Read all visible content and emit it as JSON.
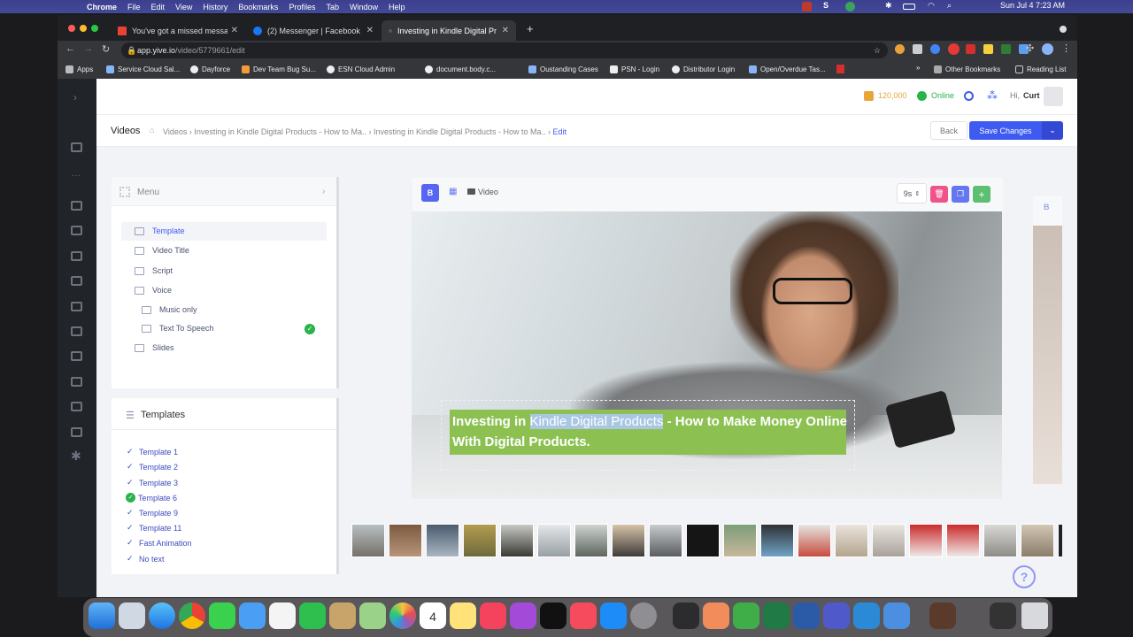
{
  "mac_menubar": {
    "app_name": "Chrome",
    "menus": [
      "File",
      "Edit",
      "View",
      "History",
      "Bookmarks",
      "Profiles",
      "Tab",
      "Window",
      "Help"
    ],
    "clock": "Sun Jul 4  7:23 AM"
  },
  "browser": {
    "tabs": [
      {
        "title": "You've got a missed message",
        "favicon": "gmail-icon"
      },
      {
        "title": "(2) Messenger | Facebook",
        "favicon": "facebook-icon"
      },
      {
        "title": "Investing in Kindle Digital Prod",
        "favicon": "yive-icon"
      }
    ],
    "url_host": "app.yive.io",
    "url_path": "/video/5779661/edit",
    "bookmarks": [
      "Apps",
      "Service Cloud Sal...",
      "Dayforce",
      "Dev Team Bug Su...",
      "ESN Cloud Admin",
      "document.body.c...",
      "Oustanding Cases",
      "PSN - Login",
      "Distributor Login",
      "Open/Overdue Tas..."
    ],
    "other_bookmarks": "Other Bookmarks",
    "reading_list": "Reading List"
  },
  "header": {
    "credits": "120,000",
    "status": "Online",
    "greeting": "Hi,",
    "user": "Curt"
  },
  "subheader": {
    "page_title": "Videos",
    "breadcrumb": [
      "Videos",
      "Investing in Kindle Digital Products - How to Ma..",
      "Investing in Kindle Digital Products - How to Ma..",
      "Edit"
    ],
    "back_label": "Back",
    "save_label": "Save Changes"
  },
  "menu": {
    "title": "Menu",
    "items": [
      {
        "label": "Template",
        "icon": "sliders-icon",
        "active": true
      },
      {
        "label": "Video Title",
        "icon": "pencil-icon"
      },
      {
        "label": "Script",
        "icon": "document-icon"
      },
      {
        "label": "Voice",
        "icon": "speaker-icon"
      },
      {
        "label": "Music only",
        "icon": "music-icon",
        "sub": true
      },
      {
        "label": "Text To Speech",
        "icon": "speech-icon",
        "sub": true,
        "checked": true
      },
      {
        "label": "Slides",
        "icon": "slides-icon"
      }
    ]
  },
  "templates": {
    "title": "Templates",
    "items": [
      "Template 1",
      "Template 2",
      "Template 3",
      "Template 6",
      "Template 9",
      "Template 11",
      "Fast Animation",
      "No text"
    ],
    "selected": "Template 6"
  },
  "editor": {
    "bold_label": "B",
    "video_label": "Video",
    "duration": "9s",
    "caption_line1_a": "Investing in ",
    "caption_line1_highlight": "Kindle Digital Products",
    "caption_line1_b": " - How to Make Money Online",
    "caption_line2": "With Digital Products.",
    "side_bold": "B"
  },
  "colors": {
    "accent": "#3d5af1",
    "caption_bg": "#8cc152",
    "delete": "#ef5389",
    "copy": "#6476f0",
    "add": "#5cbf72"
  }
}
